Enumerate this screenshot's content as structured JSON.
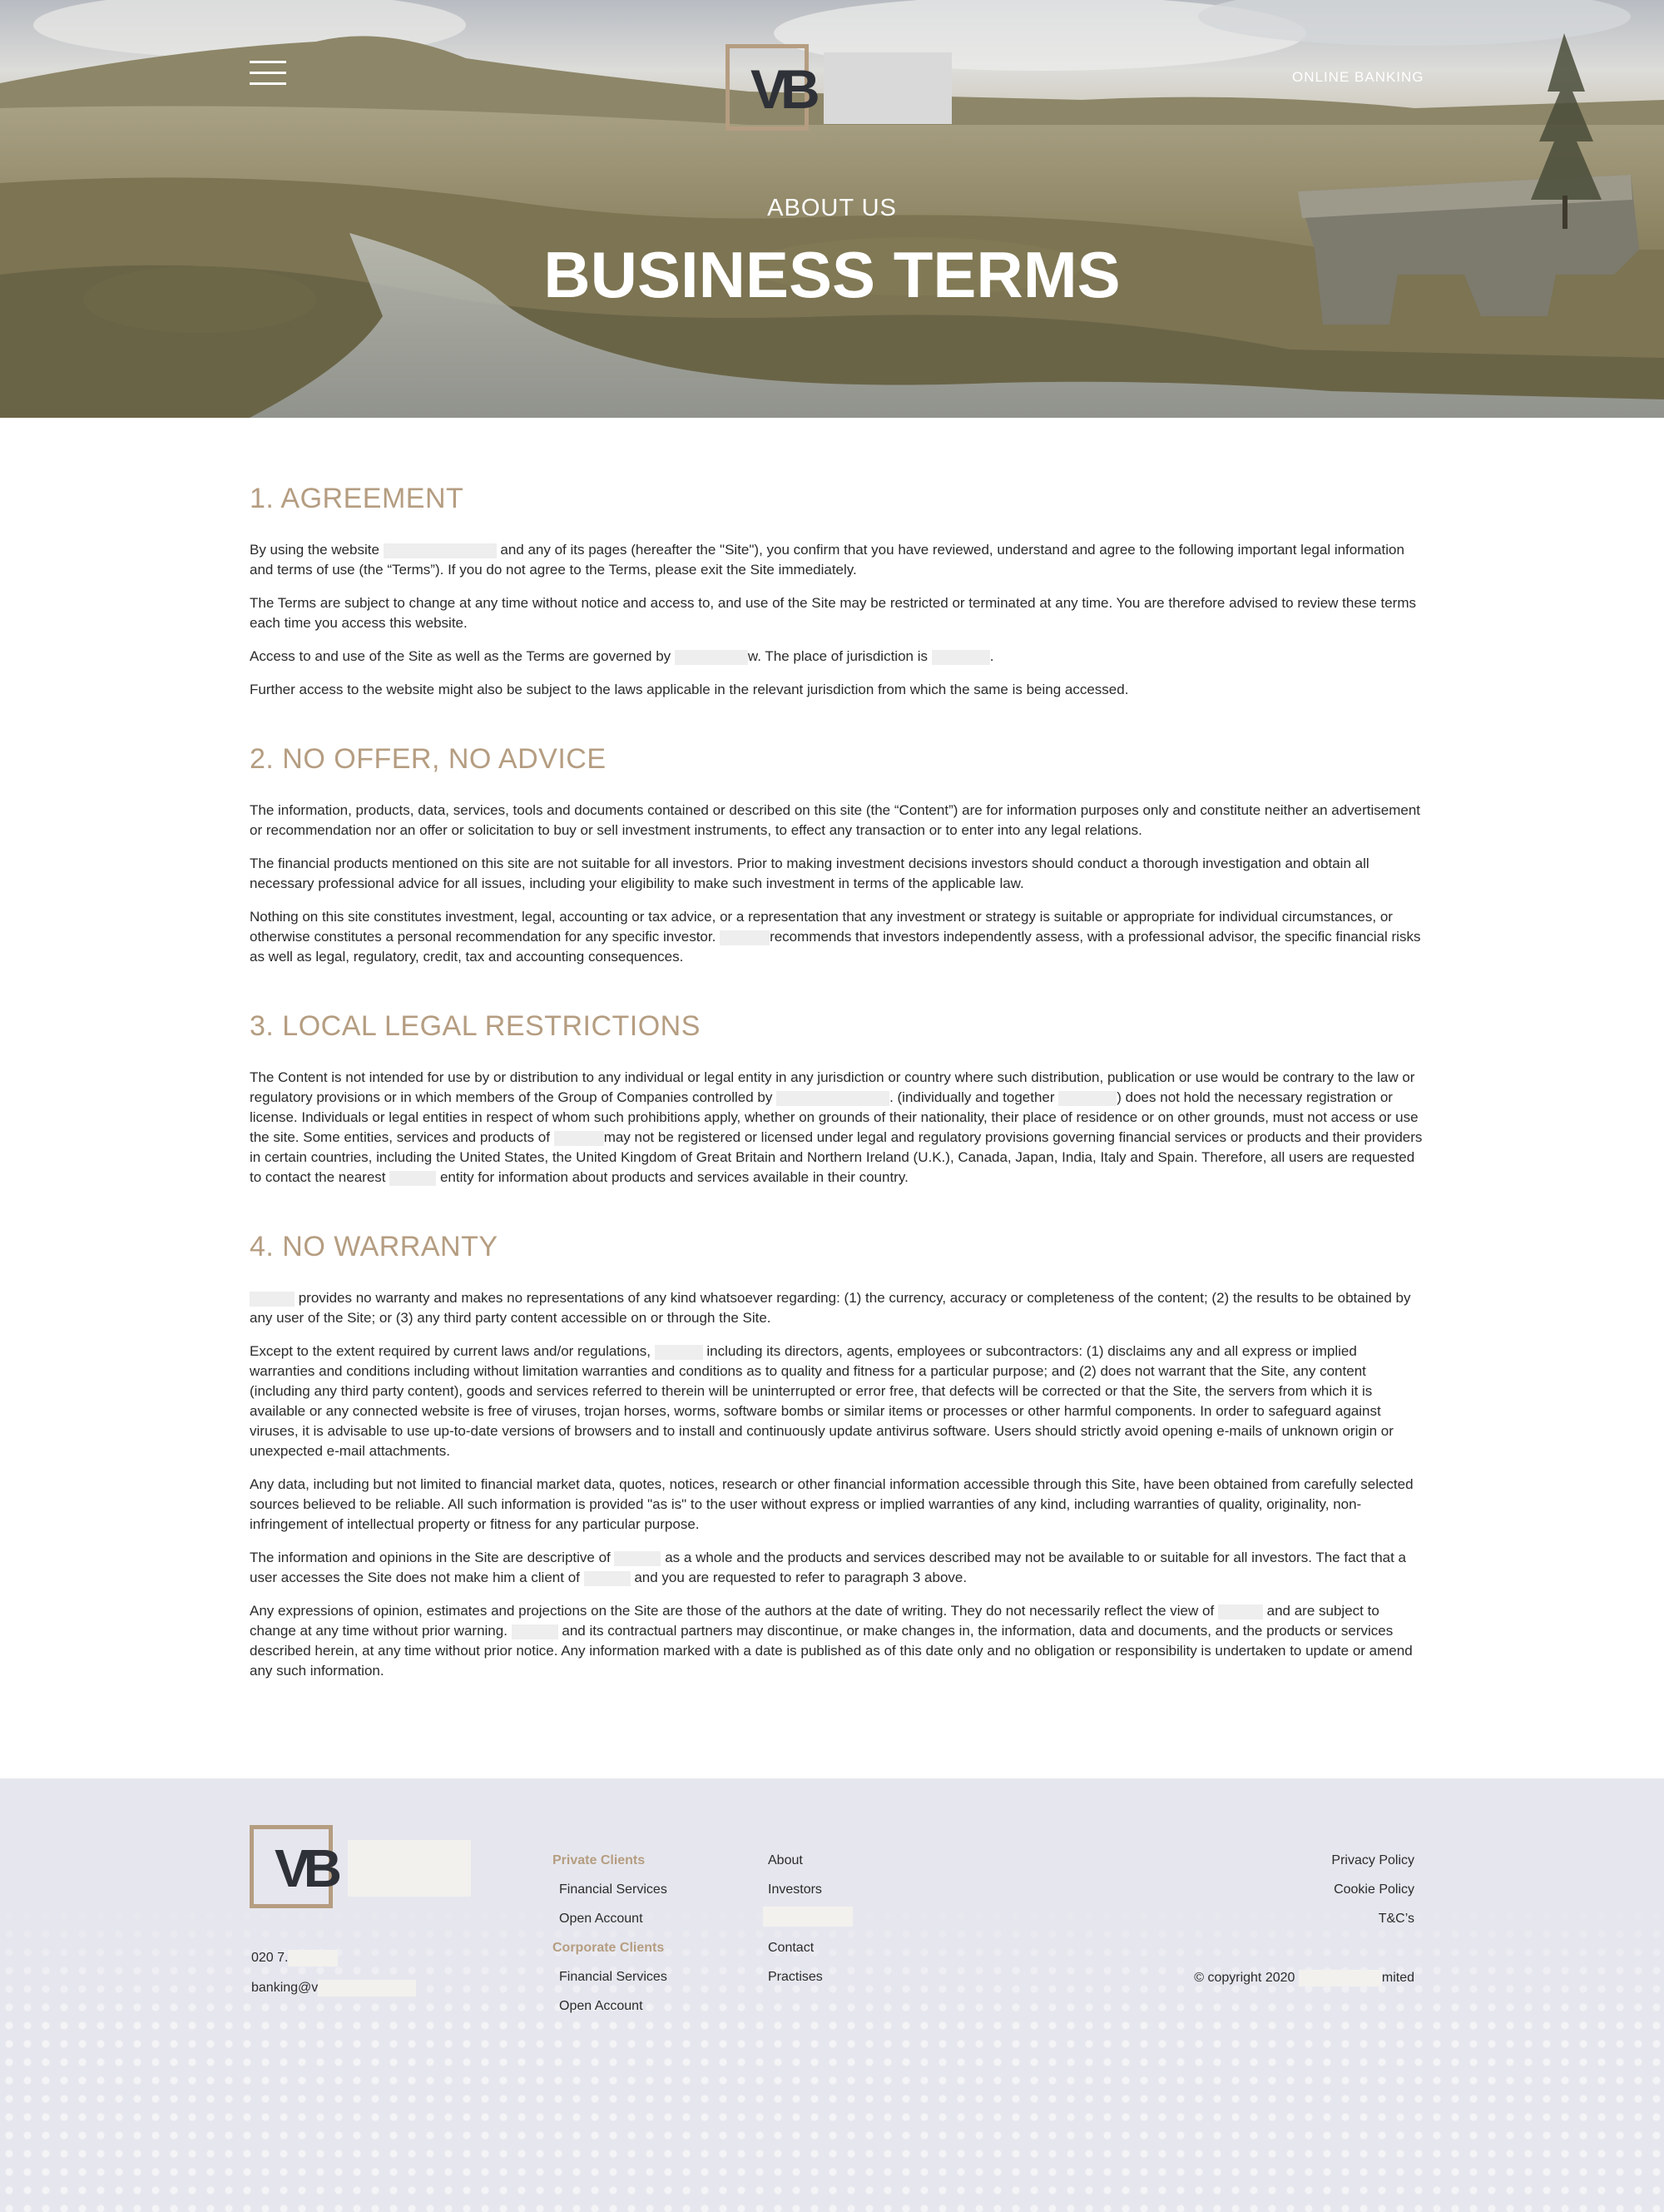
{
  "header": {
    "menu_icon": "hamburger-menu-icon",
    "logo_letters": "VB",
    "online_banking_label": "ONLINE BANKING",
    "kicker": "ABOUT US",
    "title": "BUSINESS TERMS"
  },
  "colors": {
    "accent": "#b59d81",
    "text": "#2b2b2b",
    "footer_bg": "#e6e7ee"
  },
  "sections": [
    {
      "heading": "1. AGREEMENT",
      "paragraphs": [
        [
          "By using the website ",
          "{r:136}",
          " and any of its pages (hereafter the \"Site\"), you confirm that you have reviewed, understand and agree to the following important legal information and terms of use (the “Terms”). If you do not agree to the Terms, please exit the Site immediately."
        ],
        [
          "The Terms are subject to change at any time without notice and access to, and use of the Site may be restricted or terminated at any time. You are therefore advised to review these terms each time you access this website."
        ],
        [
          "Access to and use of the Site as well as the Terms are governed by ",
          "{r:88}",
          "w. The place of jurisdiction is ",
          "{r:70}",
          "."
        ],
        [
          "Further access to the website might also be subject to the laws applicable in the relevant jurisdiction from which the same is being accessed."
        ]
      ]
    },
    {
      "heading": "2. NO OFFER, NO ADVICE",
      "paragraphs": [
        [
          "The information, products, data, services, tools and documents contained or described on this site (the “Content”) are for information purposes only and constitute neither an advertisement or recommendation nor an offer or solicitation to buy or sell investment instruments, to effect any transaction or to enter into any legal relations."
        ],
        [
          "The financial products mentioned on this site are not suitable for all investors. Prior to making investment decisions investors should conduct a thorough investigation and obtain all necessary professional advice for all issues, including your eligibility to make such investment in terms of the applicable law."
        ],
        [
          "Nothing on this site constitutes investment, legal, accounting or tax advice, or a representation that any investment or strategy is suitable or appropriate for individual circumstances, or otherwise constitutes a personal recommendation for any specific investor. ",
          "{r:60}",
          "recommends that investors independently assess, with a professional advisor, the specific financial risks as well as legal, regulatory, credit, tax and accounting consequences."
        ]
      ]
    },
    {
      "heading": "3. LOCAL LEGAL RESTRICTIONS",
      "paragraphs": [
        [
          "The Content is not intended for use by or distribution to any individual or legal entity in any jurisdiction or country where such distribution, publication or use would be contrary to the law or regulatory provisions or in which members of the Group of Companies controlled by ",
          "{r:136}",
          ". (individually and together ",
          "{r:70}",
          ") does not hold the necessary registration or license. Individuals or legal entities in respect of whom such prohibitions apply, whether on grounds of their nationality, their place of residence or on other grounds, must not access or use the site. Some entities, services and products of ",
          "{r:60}",
          "may not be registered or licensed under legal and regulatory provisions governing financial services or products and their providers in certain countries, including the United States, the United Kingdom of Great Britain and Northern Ireland (U.K.), Canada, Japan, India, Italy and Spain. Therefore, all users are requested to contact the nearest ",
          "{r:56}",
          " entity for information about products and services available in their country."
        ]
      ]
    },
    {
      "heading": "4. NO WARRANTY",
      "paragraphs": [
        [
          "{r:54}",
          " provides no warranty and makes no representations of any kind whatsoever regarding: (1) the currency, accuracy or completeness of the content; (2) the results to be obtained by any user of the Site; or (3) any third party content accessible on or through the Site."
        ],
        [
          "Except to the extent required by current laws and/or regulations, ",
          "{r:58}",
          " including its directors, agents, employees or subcontractors: (1) disclaims any and all express or implied warranties and conditions including without limitation warranties and conditions as to quality and fitness for a particular purpose; and (2) does not warrant that the Site, any content (including any third party content), goods and services referred to therein will be uninterrupted or error free, that defects will be corrected or that the Site, the servers from which it is available or any connected website is free of viruses, trojan horses, worms, software bombs or similar items or processes or other harmful components. In order to safeguard against viruses, it is advisable to use up-to-date versions of browsers and to install and continuously update antivirus software. Users should strictly avoid opening e-mails of unknown origin or unexpected e-mail attachments."
        ],
        [
          "Any data, including but not limited to financial market data, quotes, notices, research or other financial information accessible through this Site, have been obtained from carefully selected sources believed to be reliable. All such information is provided \"as is\" to the user without express or implied warranties of any kind, including warranties of quality, originality, non-infringement of intellectual property or fitness for any particular purpose."
        ],
        [
          "The information and opinions in the Site are descriptive of ",
          "{r:56}",
          " as a whole and the products and services described may not be available to or suitable for all investors. The fact that a user accesses the Site does not make him a client of ",
          "{r:56}",
          " and you are requested to refer to paragraph 3 above."
        ],
        [
          "Any expressions of opinion, estimates and projections on the Site are those of the authors at the date of writing. They do not necessarily reflect the view of ",
          "{r:54}",
          " and are subject to change at any time without prior warning. ",
          "{r:56}",
          " and its contractual partners may discontinue, or make changes in, the information, data and documents, and the products or services described herein, at any time without prior notice. Any information marked with a date is published as of this date only and no obligation or responsibility is undertaken to update or amend any such information."
        ]
      ]
    }
  ],
  "footer": {
    "logo_letters": "VB",
    "phone": "020 7.",
    "email": "banking@v",
    "private_clients": "Private Clients",
    "private_financial_services": "Financial Services",
    "private_open_account": "Open Account",
    "corporate_clients": "Corporate Clients",
    "corporate_financial_services": "Financial Services",
    "corporate_open_account": "Open Account",
    "about": "About",
    "investors": "Investors",
    "contact": "Contact",
    "practises": "Practises",
    "privacy_policy": "Privacy Policy",
    "cookie_policy": "Cookie Policy",
    "tcs": "T&C’s",
    "copyright_prefix": "© copyright 2020",
    "copyright_suffix": "mited"
  }
}
